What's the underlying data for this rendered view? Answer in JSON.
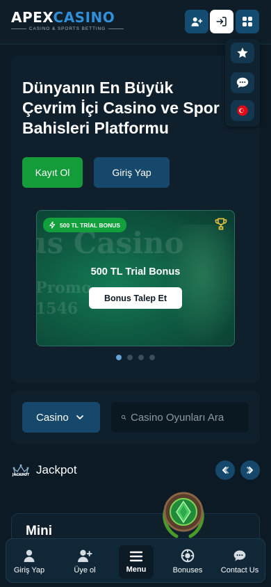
{
  "header": {
    "logo_main_1": "APEX",
    "logo_main_2": "CASINO",
    "logo_sub": "CASINO & SPORTS BETTING",
    "icons": [
      "user-plus-icon",
      "login-icon",
      "grid-apps-icon"
    ]
  },
  "side_menu": {
    "icons": [
      "star-icon",
      "support-chat-icon",
      "turkish-flag-icon"
    ]
  },
  "hero": {
    "title_lines": [
      "Dünyanın En Büyük",
      "Çevrim İçi Casino ve Spor",
      "Bahisleri Platformu"
    ],
    "register_label": "Kayıt Ol",
    "login_label": "Giriş Yap"
  },
  "bonus_card": {
    "badge": "500 TL TRİAL BONUS",
    "title": "500 TL Trial Bonus",
    "button": "Bonus Talep Et",
    "bg_text": "us Casino",
    "bg_text2_line1": "Promo",
    "bg_text2_line2": "1546",
    "slides_total": 4,
    "active_slide": 1
  },
  "search": {
    "category": "Casino",
    "placeholder": "Casino Oyunları Ara"
  },
  "jackpot": {
    "label": "Jackpot",
    "icon_text": "JACKPOT",
    "mini_label": "Mini"
  },
  "bottom_nav": {
    "items": [
      {
        "label": "Giriş Yap",
        "icon": "user-icon"
      },
      {
        "label": "Üye ol",
        "icon": "user-plus-icon"
      },
      {
        "label": "Menu",
        "icon": "hamburger-icon"
      },
      {
        "label": "Bonuses",
        "icon": "bonus-chip-icon"
      },
      {
        "label": "Contact Us",
        "icon": "support-chat-icon"
      }
    ]
  },
  "colors": {
    "background": "#0b1a24",
    "panel": "#0f202c",
    "primary_blue": "#15486a",
    "green": "#149c3a",
    "accent_blue": "#2f8fd8"
  }
}
